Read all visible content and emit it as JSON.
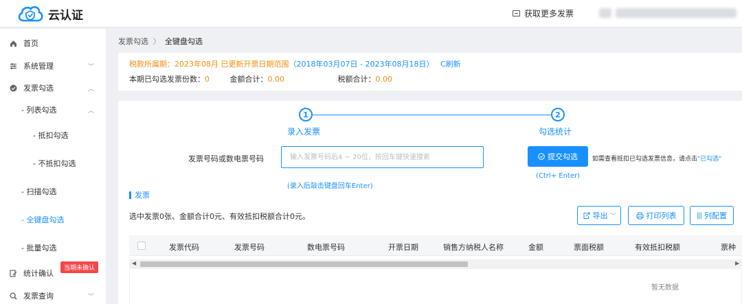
{
  "app": {
    "name": "云认证"
  },
  "header": {
    "more_invoices": "获取更多发票"
  },
  "sidebar": {
    "home": "首页",
    "system": "系统管理",
    "invoice_select": "发票勾选",
    "list_select": "- 列表勾选",
    "deduct_select": "- 抵扣勾选",
    "no_deduct_select": "- 不抵扣勾选",
    "scan_select": "- 扫描勾选",
    "keyboard_select": "- 全键盘勾选",
    "batch_select": "- 批量勾选",
    "stats_confirm": "统计确认",
    "stats_badge": "当期未确认",
    "invoice_query": "发票查询"
  },
  "breadcrumb": {
    "parent": "发票勾选",
    "sep": "〉",
    "current": "全键盘勾选"
  },
  "info": {
    "tax_period_prefix": "税款所属期：2023年08月 已更新开票日期范围",
    "tax_range": "（2018年03月07日 - 2023年08月18日）",
    "refresh": "C刷新",
    "selected_count_label": "本期已勾选发票份数：",
    "selected_count": "0",
    "amount_label": "金额合计：",
    "amount": "0.00",
    "tax_label": "税额合计：",
    "tax": "0.00"
  },
  "steps": [
    {
      "num": "1",
      "label": "录入发票"
    },
    {
      "num": "2",
      "label": "勾选统计"
    }
  ],
  "form": {
    "field_label": "发票号码或数电票号码",
    "placeholder": "输入发票号码后4 ~ 20位，按回车键快速搜索",
    "hint": "(录入后敲击键盘回车Enter)"
  },
  "submit": {
    "label": "提交勾选",
    "shortcut": "(Ctrl+ Enter)",
    "tip_prefix": "如需查看抵扣已勾选发票信息，请点击",
    "tip_link": "\"已勾选\""
  },
  "section": {
    "title": "发票"
  },
  "summary": "选中发票0张、金额合计0元、有效抵扣税额合计0元。",
  "toolbar": {
    "export": "导出",
    "print": "打印列表",
    "columns": "列配置"
  },
  "table": {
    "columns": [
      "发票代码",
      "发票号码",
      "数电票号码",
      "开票日期",
      "销售方纳税人名称",
      "金额",
      "票面税额",
      "有效抵扣税额",
      "票种"
    ],
    "empty": "暂无数据"
  }
}
